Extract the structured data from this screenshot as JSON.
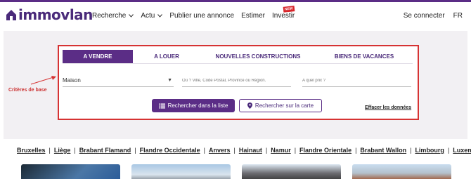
{
  "header": {
    "logo_text": "immovlan",
    "nav": [
      {
        "label": "Recherche",
        "has_dropdown": true
      },
      {
        "label": "Actu",
        "has_dropdown": true
      },
      {
        "label": "Publier une annonce",
        "has_dropdown": false
      },
      {
        "label": "Estimer",
        "has_dropdown": false
      },
      {
        "label": "Investir",
        "has_dropdown": false,
        "badge": "NEW"
      }
    ],
    "login": "Se connecter",
    "language": "FR"
  },
  "annotation": {
    "label": "Critères de base"
  },
  "search": {
    "tabs": [
      {
        "label": "A VENDRE",
        "active": true
      },
      {
        "label": "A LOUER",
        "active": false
      },
      {
        "label": "NOUVELLES CONSTRUCTIONS",
        "active": false
      },
      {
        "label": "BIENS DE VACANCES",
        "active": false
      }
    ],
    "property_type": "Maison",
    "where_placeholder": "Où ? Ville, Code Postal, Province ou Région.",
    "price_placeholder": "A quel prix ?",
    "list_button": "Rechercher dans la liste",
    "map_button": "Rechercher sur la carte",
    "clear_link": "Effacer les données"
  },
  "regions": [
    "Bruxelles",
    "Liège",
    "Brabant Flamand",
    "Flandre Occidentale",
    "Anvers",
    "Hainaut",
    "Namur",
    "Flandre Orientale",
    "Brabant Wallon",
    "Limbourg",
    "Luxembourg"
  ],
  "colors": {
    "brand": "#5b2d86",
    "annotation": "#d63333",
    "badge": "#d7262b"
  }
}
